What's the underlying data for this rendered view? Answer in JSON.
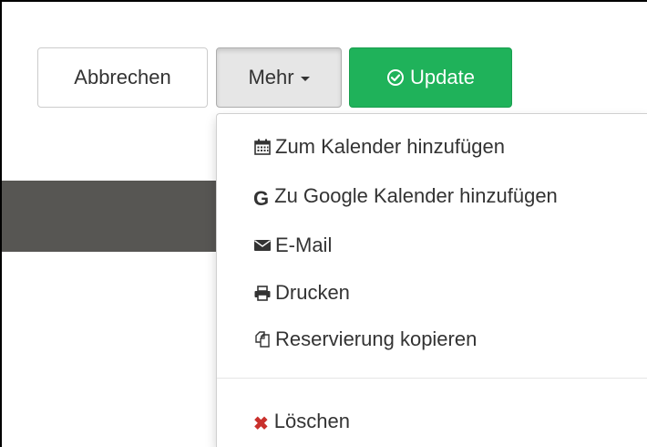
{
  "toolbar": {
    "cancel_label": "Abbrechen",
    "more_label": "Mehr",
    "update_label": "Update"
  },
  "menu": {
    "items": [
      {
        "label": "Zum Kalender hinzufügen",
        "icon": "calendar-icon"
      },
      {
        "label": "Zu Google Kalender hinzufügen",
        "icon": "google-icon",
        "icon_text": "G"
      },
      {
        "label": "E-Mail",
        "icon": "envelope-icon"
      },
      {
        "label": "Drucken",
        "icon": "print-icon"
      },
      {
        "label": "Reservierung kopieren",
        "icon": "copy-icon"
      },
      {
        "label": "Löschen",
        "icon": "delete-icon",
        "icon_text": "✖"
      }
    ]
  },
  "colors": {
    "update_bg": "#1fb25a",
    "delete_icon": "#c9302c",
    "dark_band": "#575653"
  }
}
